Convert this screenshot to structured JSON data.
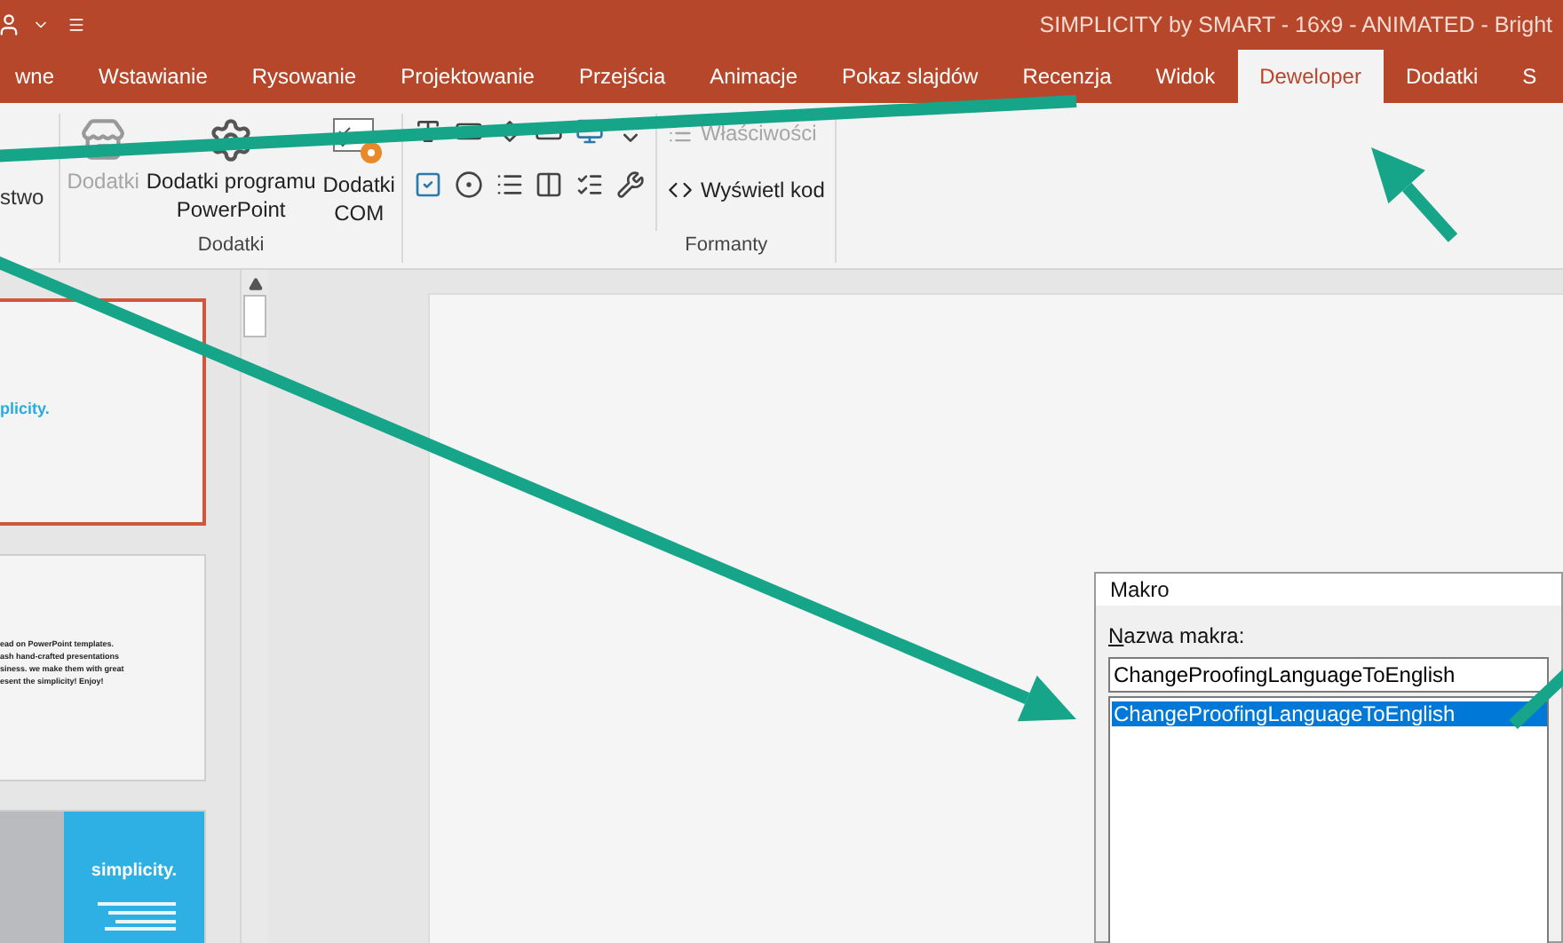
{
  "title_bar": {
    "title": "SIMPLICITY by SMART - 16x9 - ANIMATED - Bright"
  },
  "tabs": [
    {
      "label": "wne",
      "selected": false
    },
    {
      "label": "Wstawianie",
      "selected": false
    },
    {
      "label": "Rysowanie",
      "selected": false
    },
    {
      "label": "Projektowanie",
      "selected": false
    },
    {
      "label": "Przejścia",
      "selected": false
    },
    {
      "label": "Animacje",
      "selected": false
    },
    {
      "label": "Pokaz slajdów",
      "selected": false
    },
    {
      "label": "Recenzja",
      "selected": false
    },
    {
      "label": "Widok",
      "selected": false
    },
    {
      "label": "Deweloper",
      "selected": true
    },
    {
      "label": "Dodatki",
      "selected": false
    },
    {
      "label": "S",
      "selected": false
    }
  ],
  "ribbon": {
    "cut_button": "stwo",
    "addins_group": {
      "label": "Dodatki",
      "buttons": [
        {
          "kind": "store",
          "lines": [
            "Dodatki"
          ],
          "disabled": true
        },
        {
          "kind": "gear",
          "lines": [
            "Dodatki programu",
            "PowerPoint"
          ],
          "disabled": false
        },
        {
          "kind": "com",
          "lines": [
            "Dodatki",
            "COM"
          ],
          "disabled": false
        }
      ]
    },
    "controls_group": {
      "label": "Formanty",
      "controls": [
        {
          "kind": "label"
        },
        {
          "kind": "textbox"
        },
        {
          "kind": "spin"
        },
        {
          "kind": "button"
        },
        {
          "kind": "image"
        },
        {
          "kind": "scroll"
        },
        {
          "kind": "checkbox"
        },
        {
          "kind": "radio"
        },
        {
          "kind": "listbox"
        },
        {
          "kind": "combobox"
        },
        {
          "kind": "toggle"
        },
        {
          "kind": "more"
        }
      ],
      "buttons": [
        {
          "kind": "properties",
          "label": "Właściwości",
          "disabled": true
        },
        {
          "kind": "code",
          "label": "Wyświetl kod",
          "disabled": false
        }
      ]
    }
  },
  "slides": [
    {
      "kind": "title",
      "selected": true,
      "texts": [
        "plicity."
      ]
    },
    {
      "kind": "text",
      "selected": false,
      "texts": [
        "ead on PowerPoint templates.",
        "ash hand-crafted presentations",
        "siness. we make them with great",
        "esent the simplicity! Enjoy!"
      ]
    },
    {
      "kind": "split",
      "selected": false,
      "texts": [
        "simplicity."
      ]
    }
  ],
  "dialog": {
    "title": "Makro",
    "name_label": "Nazwa makra:",
    "name_value": "ChangeProofingLanguageToEnglish",
    "macros": [
      {
        "name": "ChangeProofingLanguageToEnglish",
        "selected": true
      }
    ]
  }
}
